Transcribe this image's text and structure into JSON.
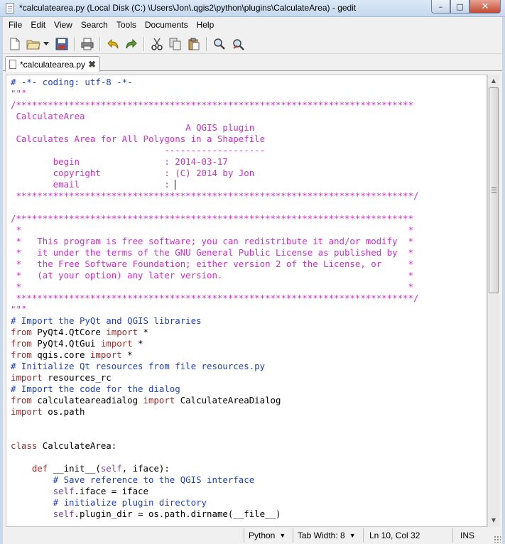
{
  "window": {
    "title": "*calculatearea.py (Local Disk (C:) \\Users\\Jon\\.qgis2\\python\\plugins\\CalculateArea) - gedit",
    "minimize": "–",
    "maximize": "□",
    "close": "✕"
  },
  "menu": {
    "file": "File",
    "edit": "Edit",
    "view": "View",
    "search": "Search",
    "tools": "Tools",
    "documents": "Documents",
    "help": "Help"
  },
  "toolbar_icons": [
    "new-document-icon",
    "open-folder-icon",
    "save-icon",
    "print-icon",
    "undo-icon",
    "redo-icon",
    "cut-icon",
    "copy-icon",
    "paste-icon",
    "find-icon",
    "replace-icon"
  ],
  "tab": {
    "label": "*calculatearea.py",
    "close": "✖"
  },
  "colors": {
    "comment": "#d42cd4",
    "string": "#1e3fcc",
    "keyword": "#a52a2a",
    "self": "#7a3fa5"
  },
  "code_lines": [
    [
      {
        "t": "# -*- coding: utf-8 -*-",
        "c": "b"
      }
    ],
    [
      {
        "t": "\"\"\"",
        "c": "m"
      }
    ],
    [
      {
        "t": "/***************************************************************************",
        "c": "m"
      }
    ],
    [
      {
        "t": " CalculateArea",
        "c": "m"
      }
    ],
    [
      {
        "t": "                                 A QGIS plugin",
        "c": "m"
      }
    ],
    [
      {
        "t": " Calculates Area for All Polygons in a Shapefile",
        "c": "m"
      }
    ],
    [
      {
        "t": "                             -------------------",
        "c": "m"
      }
    ],
    [
      {
        "t": "        begin                : 2014-03-17",
        "c": "m"
      }
    ],
    [
      {
        "t": "        copyright            : (C) 2014 by Jon",
        "c": "m"
      }
    ],
    [
      {
        "t": "        email                : ",
        "c": "m"
      },
      {
        "t": "",
        "c": "cursor"
      }
    ],
    [
      {
        "t": " ***************************************************************************/",
        "c": "m"
      }
    ],
    [
      {
        "t": "",
        "c": ""
      }
    ],
    [
      {
        "t": "/***************************************************************************",
        "c": "m"
      }
    ],
    [
      {
        "t": " *                                                                         *",
        "c": "m"
      }
    ],
    [
      {
        "t": " *   This program is free software; you can redistribute it and/or modify  *",
        "c": "m"
      }
    ],
    [
      {
        "t": " *   it under the terms of the GNU General Public License as published by  *",
        "c": "m"
      }
    ],
    [
      {
        "t": " *   the Free Software Foundation; either version 2 of the License, or     *",
        "c": "m"
      }
    ],
    [
      {
        "t": " *   (at your option) any later version.                                   *",
        "c": "m"
      }
    ],
    [
      {
        "t": " *                                                                         *",
        "c": "m"
      }
    ],
    [
      {
        "t": " ***************************************************************************/",
        "c": "m"
      }
    ],
    [
      {
        "t": "\"\"\"",
        "c": "m"
      }
    ],
    [
      {
        "t": "# Import the PyQt and QGIS libraries",
        "c": "b"
      }
    ],
    [
      {
        "t": "from",
        "c": "k"
      },
      {
        "t": " PyQt4.QtCore ",
        "c": ""
      },
      {
        "t": "import",
        "c": "k"
      },
      {
        "t": " *",
        "c": ""
      }
    ],
    [
      {
        "t": "from",
        "c": "k"
      },
      {
        "t": " PyQt4.QtGui ",
        "c": ""
      },
      {
        "t": "import",
        "c": "k"
      },
      {
        "t": " *",
        "c": ""
      }
    ],
    [
      {
        "t": "from",
        "c": "k"
      },
      {
        "t": " qgis.core ",
        "c": ""
      },
      {
        "t": "import",
        "c": "k"
      },
      {
        "t": " *",
        "c": ""
      }
    ],
    [
      {
        "t": "# Initialize Qt resources from file resources.py",
        "c": "b"
      }
    ],
    [
      {
        "t": "import",
        "c": "k"
      },
      {
        "t": " resources_rc",
        "c": ""
      }
    ],
    [
      {
        "t": "# Import the code for the dialog",
        "c": "b"
      }
    ],
    [
      {
        "t": "from",
        "c": "k"
      },
      {
        "t": " calculateareadialog ",
        "c": ""
      },
      {
        "t": "import",
        "c": "k"
      },
      {
        "t": " CalculateAreaDialog",
        "c": ""
      }
    ],
    [
      {
        "t": "import",
        "c": "k"
      },
      {
        "t": " os.path",
        "c": ""
      }
    ],
    [
      {
        "t": "",
        "c": ""
      }
    ],
    [
      {
        "t": "",
        "c": ""
      }
    ],
    [
      {
        "t": "class",
        "c": "k"
      },
      {
        "t": " CalculateArea:",
        "c": ""
      }
    ],
    [
      {
        "t": "",
        "c": ""
      }
    ],
    [
      {
        "t": "    ",
        "c": ""
      },
      {
        "t": "def",
        "c": "k"
      },
      {
        "t": " __init__(",
        "c": ""
      },
      {
        "t": "self",
        "c": "s"
      },
      {
        "t": ", iface):",
        "c": ""
      }
    ],
    [
      {
        "t": "        # Save reference to the QGIS interface",
        "c": "b"
      }
    ],
    [
      {
        "t": "        ",
        "c": ""
      },
      {
        "t": "self",
        "c": "s"
      },
      {
        "t": ".iface = iface",
        "c": ""
      }
    ],
    [
      {
        "t": "        # initialize plugin directory",
        "c": "b"
      }
    ],
    [
      {
        "t": "        ",
        "c": ""
      },
      {
        "t": "self",
        "c": "s"
      },
      {
        "t": ".plugin_dir = os.path.dirname(__file__)",
        "c": ""
      }
    ]
  ],
  "status": {
    "language": "Python",
    "tab_width": "Tab Width: 8",
    "position": "Ln 10, Col 32",
    "mode": "INS"
  }
}
